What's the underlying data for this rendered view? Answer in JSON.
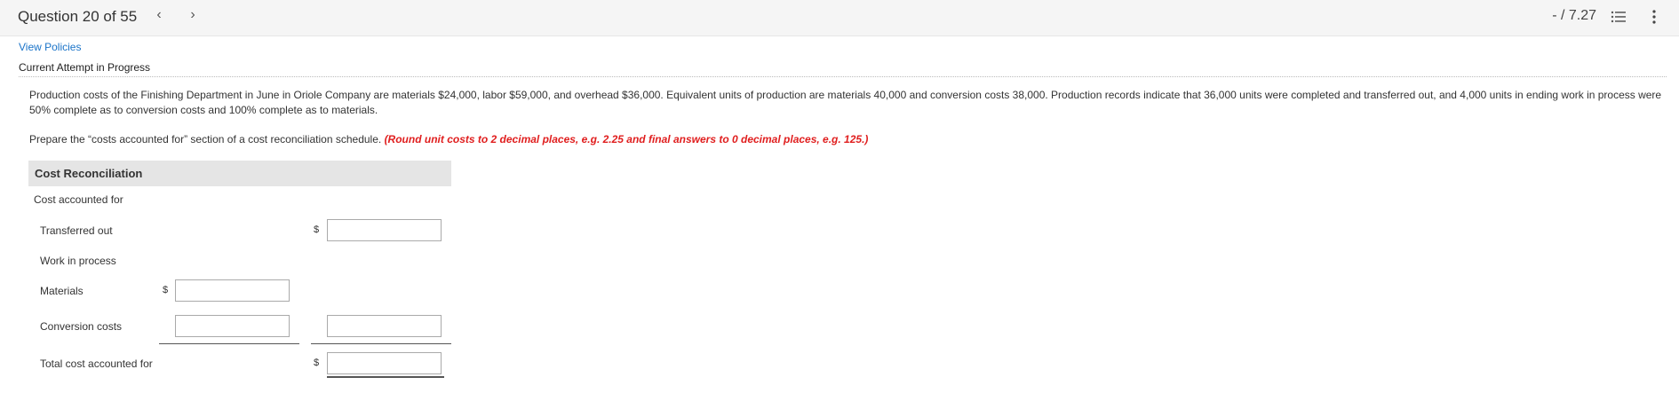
{
  "header": {
    "question_counter": "Question 20 of 55",
    "prev_label": "‹",
    "next_label": "›",
    "score": "- / 7.27"
  },
  "links": {
    "view_policies": "View Policies"
  },
  "status": {
    "attempt": "Current Attempt in Progress"
  },
  "problem": {
    "text": "Production costs of the Finishing Department in June in Oriole Company are materials $24,000, labor $59,000, and overhead $36,000. Equivalent units of production are materials 40,000 and conversion costs 38,000. Production records indicate that 36,000 units were completed and transferred out, and 4,000 units in ending work in process were 50% complete as to conversion costs and 100% complete as to materials.",
    "instruction": "Prepare the “costs accounted for” section of a cost reconciliation schedule.",
    "note": "(Round unit costs to 2 decimal places, e.g. 2.25 and final answers to 0 decimal places, e.g. 125.)"
  },
  "schedule": {
    "title": "Cost Reconciliation",
    "subtitle": "Cost accounted for",
    "rows": {
      "transferred_out": "Transferred out",
      "work_in_process": "Work in process",
      "materials": "Materials",
      "conversion_costs": "Conversion costs",
      "total": "Total cost accounted for"
    },
    "currency_symbol": "$",
    "inputs": {
      "transferred_out": "",
      "materials": "",
      "conversion_costs_left": "",
      "conversion_costs_right": "",
      "total": ""
    }
  },
  "icons": {
    "list": "list-icon",
    "more": "kebab-menu-icon"
  },
  "colors": {
    "link": "#1a73c8",
    "note": "#e01e1e",
    "header_bg": "#e5e5e5"
  }
}
